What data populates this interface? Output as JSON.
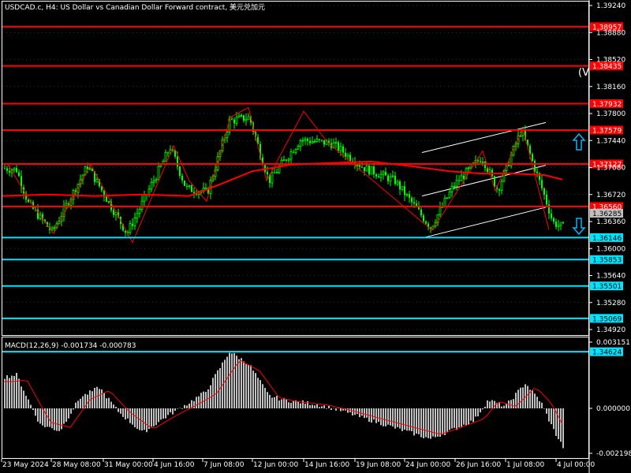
{
  "header": {
    "title": "USDCAD.c, H4:  US Dollar vs Canadian Dollar Forward contract, 美元兑加元"
  },
  "price_axis": {
    "ticks": [
      "1.39240",
      "1.38880",
      "1.38520",
      "1.38160",
      "1.37800",
      "1.37440",
      "1.37080",
      "1.36720",
      "1.36360",
      "1.36000",
      "1.35640",
      "1.35280",
      "1.34920"
    ]
  },
  "date_axis": {
    "labels": [
      "23 May 2024",
      "28 May 08:00",
      "31 May 00:00",
      "4 Jun 16:00",
      "7 Jun 08:00",
      "12 Jun 00:00",
      "14 Jun 16:00",
      "19 Jun 08:00",
      "24 Jun 00:00",
      "26 Jun 16:00",
      "1 Jul 08:00",
      "4 Jul 00:00"
    ]
  },
  "resistance_levels": {
    "color": "#ff0000",
    "values": [
      1.38957,
      1.38435,
      1.37932,
      1.37579,
      1.37127,
      1.3656
    ]
  },
  "support_levels": {
    "color": "#00e5ff",
    "values": [
      1.36146,
      1.35853,
      1.35501,
      1.35069,
      1.34624
    ]
  },
  "current_price": {
    "value": "1.36285"
  },
  "signals": {
    "up_arrow_icon": "arrow-up-outline",
    "down_arrow_icon": "arrow-down-outline",
    "script_marker": "(V"
  },
  "macd": {
    "label": "MACD(12,26,9) -0.001734 -0.000783",
    "ticks": [
      "0.003151",
      "0.000000",
      "-0.002198"
    ]
  },
  "colors": {
    "background": "#000000",
    "candle_up": "#00ff00",
    "candle_down": "#00ff00",
    "moving_average": "#ff0000",
    "zigzag": "#ff0000",
    "channel": "#ffffff",
    "histogram": "#c0c0c0",
    "signal_line": "#ff0000",
    "grid": "#ffffff"
  }
}
